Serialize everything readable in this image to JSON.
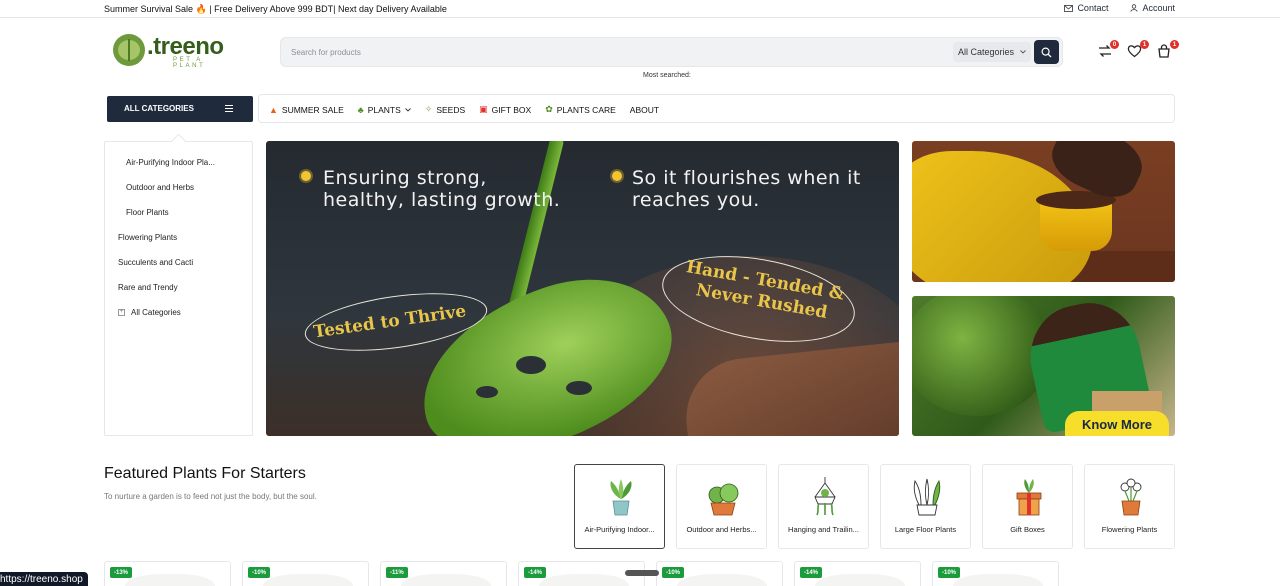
{
  "topbar": {
    "promo": "Summer Survival Sale 🔥 | Free Delivery Above 999 BDT| Next day Delivery Available",
    "contact": "Contact",
    "account": "Account"
  },
  "logo": {
    "name": ".treeno",
    "tagline": "PET A PLANT"
  },
  "search": {
    "placeholder": "Search for products",
    "category": "All Categories",
    "most_searched": "Most searched:"
  },
  "header_icons": {
    "compare_count": "0",
    "wishlist_count": "1",
    "cart_count": "1"
  },
  "nav": {
    "all_categories": "ALL CATEGORIES",
    "items": [
      {
        "label": "SUMMER SALE",
        "icon": "fire-icon"
      },
      {
        "label": "PLANTS",
        "icon": "plant-icon"
      },
      {
        "label": "SEEDS",
        "icon": "seed-icon"
      },
      {
        "label": "GIFT BOX",
        "icon": "gift-icon"
      },
      {
        "label": "PLANTS CARE",
        "icon": "care-icon"
      },
      {
        "label": "ABOUT",
        "icon": ""
      }
    ]
  },
  "sidebar": {
    "items": [
      "Air-Purifying Indoor Pla...",
      "Outdoor and Herbs",
      "Floor Plants",
      "Flowering Plants",
      "Succulents and Cacti",
      "Rare and Trendy",
      "All Categories"
    ]
  },
  "hero": {
    "text_left": "Ensuring strong, healthy, lasting growth.",
    "text_right": "So it flourishes when it reaches you.",
    "badge_left": "Tested to Thrive",
    "badge_right": "Hand - Tended & Never Rushed"
  },
  "side_banner": {
    "cta": "Know More"
  },
  "featured": {
    "title": "Featured Plants For Starters",
    "subtitle": "To nurture a garden is to feed not just the body, but the soul.",
    "categories": [
      {
        "label": "Air-Purifying Indoor...",
        "icon": "potted-plant-icon"
      },
      {
        "label": "Outdoor and Herbs...",
        "icon": "herb-bush-icon"
      },
      {
        "label": "Hanging and Trailin...",
        "icon": "hanging-plant-icon"
      },
      {
        "label": "Large Floor Plants",
        "icon": "floor-plant-icon"
      },
      {
        "label": "Gift Boxes",
        "icon": "gift-box-icon"
      },
      {
        "label": "Flowering Plants",
        "icon": "flower-pot-icon"
      }
    ]
  },
  "products": [
    {
      "discount": "-13%"
    },
    {
      "discount": "-10%"
    },
    {
      "discount": "-11%"
    },
    {
      "discount": "-14%"
    },
    {
      "discount": "-10%"
    },
    {
      "discount": "-14%"
    },
    {
      "discount": "-10%"
    }
  ],
  "status_url": "https://treeno.shop",
  "colors": {
    "brand_dark": "#1f2a3c",
    "brand_green": "#355e1c",
    "discount_green": "#1a9b3c",
    "badge_red": "#e0312b",
    "cta_yellow": "#f6de2a"
  }
}
